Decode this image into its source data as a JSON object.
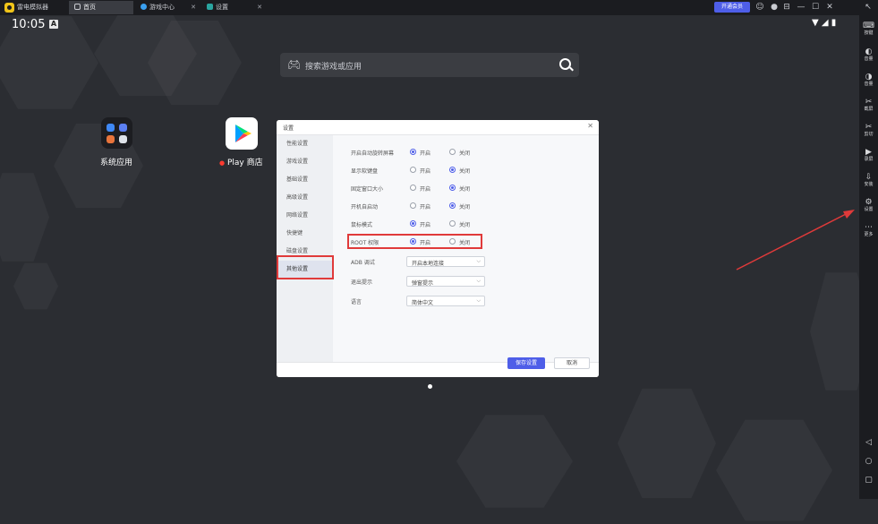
{
  "titlebar": {
    "app_title": "雷电模拟器",
    "tabs": [
      {
        "label": "首页",
        "active": true
      },
      {
        "label": "游戏中心",
        "active": false
      },
      {
        "label": "设置",
        "active": false
      }
    ],
    "vip_label": "开通会员",
    "window_controls": [
      "⊟",
      "—",
      "☐",
      "✕"
    ]
  },
  "status": {
    "time": "10:05",
    "badge": "A"
  },
  "search": {
    "placeholder": "搜索游戏或应用"
  },
  "desktop": {
    "apps": [
      {
        "label": "系统应用"
      },
      {
        "label": "Play 商店",
        "dot": "●"
      }
    ]
  },
  "sidebar": {
    "items": [
      {
        "icon": "⌨",
        "label": "按键"
      },
      {
        "icon": "◐",
        "label": "音量"
      },
      {
        "icon": "◑",
        "label": "音量"
      },
      {
        "icon": "✂",
        "label": "截屏"
      },
      {
        "icon": "✂",
        "label": "剪切"
      },
      {
        "icon": "▶",
        "label": "录屏"
      },
      {
        "icon": "⇩",
        "label": "安装"
      },
      {
        "icon": "⚙",
        "label": "设置"
      },
      {
        "icon": "⋯",
        "label": "更多"
      }
    ],
    "nav": [
      "◁",
      "○",
      "▢"
    ]
  },
  "dialog": {
    "title": "设置",
    "nav": [
      {
        "label": "性能设置",
        "active": false
      },
      {
        "label": "游戏设置",
        "active": false
      },
      {
        "label": "基础设置",
        "active": false
      },
      {
        "label": "高级设置",
        "active": false
      },
      {
        "label": "网络设置",
        "active": false
      },
      {
        "label": "快捷键",
        "active": false
      },
      {
        "label": "磁盘设置",
        "active": false
      },
      {
        "label": "其他设置",
        "active": true
      }
    ],
    "rows": [
      {
        "label": "开启自动旋转屏幕",
        "options": [
          "开启",
          "关闭"
        ],
        "selected": 0
      },
      {
        "label": "显示软键盘",
        "options": [
          "开启",
          "关闭"
        ],
        "selected": 1
      },
      {
        "label": "固定窗口大小",
        "options": [
          "开启",
          "关闭"
        ],
        "selected": 1
      },
      {
        "label": "开机自启动",
        "options": [
          "开启",
          "关闭"
        ],
        "selected": 1
      },
      {
        "label": "鼠标模式",
        "options": [
          "开启",
          "关闭"
        ],
        "selected": 0
      },
      {
        "label": "ROOT 权限",
        "options": [
          "开启",
          "关闭"
        ],
        "selected": 0
      }
    ],
    "selects": [
      {
        "label": "ADB 调试",
        "value": "开启本地连接"
      },
      {
        "label": "退出提示",
        "value": "弹窗提示"
      },
      {
        "label": "语言",
        "value": "简体中文"
      }
    ],
    "save_label": "保存设置",
    "cancel_label": "取消"
  },
  "colors": {
    "accent": "#4e5ee8",
    "highlight": "#e03a3a",
    "desktop_bg": "#2b2d32"
  }
}
